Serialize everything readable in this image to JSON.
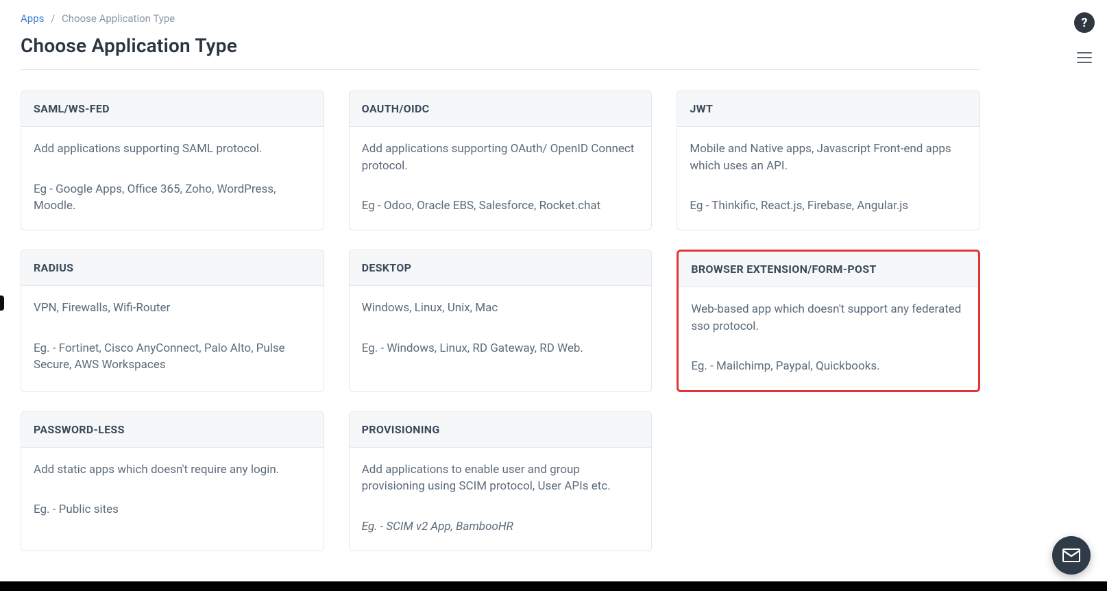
{
  "breadcrumb": {
    "root": "Apps",
    "current": "Choose Application Type"
  },
  "page": {
    "title": "Choose Application Type"
  },
  "cards": [
    {
      "title": "SAML/WS-FED",
      "desc": "Add applications supporting SAML protocol.",
      "eg": "Eg - Google Apps, Office 365, Zoho, WordPress, Moodle.",
      "highlight": false,
      "italicEg": false
    },
    {
      "title": "OAUTH/OIDC",
      "desc": "Add applications supporting OAuth/ OpenID Connect protocol.",
      "eg": "Eg - Odoo, Oracle EBS, Salesforce, Rocket.chat",
      "highlight": false,
      "italicEg": false
    },
    {
      "title": "JWT",
      "desc": "Mobile and Native apps, Javascript Front-end apps which uses an API.",
      "eg": "Eg - Thinkific, React.js, Firebase, Angular.js",
      "highlight": false,
      "italicEg": false
    },
    {
      "title": "RADIUS",
      "desc": "VPN, Firewalls, Wifi-Router",
      "eg": "Eg. - Fortinet, Cisco AnyConnect, Palo Alto, Pulse Secure, AWS Workspaces",
      "highlight": false,
      "italicEg": false
    },
    {
      "title": "DESKTOP",
      "desc": "Windows, Linux, Unix, Mac",
      "eg": "Eg. - Windows, Linux, RD Gateway, RD Web.",
      "highlight": false,
      "italicEg": false
    },
    {
      "title": "BROWSER EXTENSION/FORM-POST",
      "desc": "Web-based app which doesn't support any federated sso protocol.",
      "eg": "Eg. - Mailchimp, Paypal, Quickbooks.",
      "highlight": true,
      "italicEg": false
    },
    {
      "title": "PASSWORD-LESS",
      "desc": "Add static apps which doesn't require any login.",
      "eg": "Eg. - Public sites",
      "highlight": false,
      "italicEg": false
    },
    {
      "title": "PROVISIONING",
      "desc": "Add applications to enable user and group provisioning using SCIM protocol, User APIs etc.",
      "eg": "Eg. - SCIM v2 App, BambooHR",
      "highlight": false,
      "italicEg": true
    }
  ],
  "icons": {
    "help": "?",
    "menu": "menu-icon",
    "chat": "mail-icon"
  }
}
